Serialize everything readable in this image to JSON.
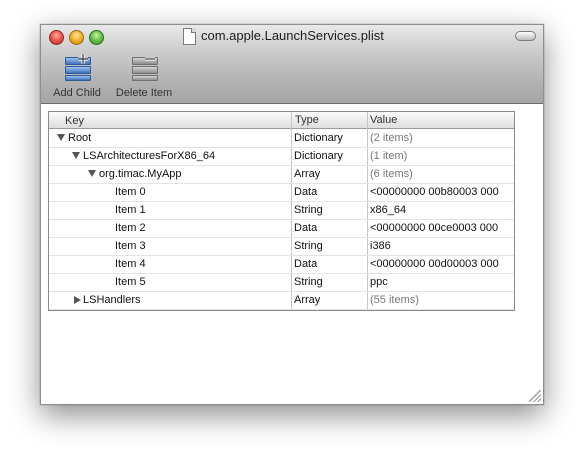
{
  "window": {
    "title": "com.apple.LaunchServices.plist"
  },
  "toolbar": {
    "add_child_label": "Add Child",
    "delete_item_label": "Delete Item"
  },
  "table": {
    "headers": {
      "key": "Key",
      "type": "Type",
      "value": "Value"
    },
    "rows": [
      {
        "key": "Root",
        "type": "Dictionary",
        "value": "(2 items)",
        "disclosure": "expanded"
      },
      {
        "key": "LSArchitecturesForX86_64",
        "type": "Dictionary",
        "value": "(1 item)",
        "disclosure": "expanded"
      },
      {
        "key": "org.timac.MyApp",
        "type": "Array",
        "value": "(6 items)",
        "disclosure": "expanded"
      },
      {
        "key": "Item 0",
        "type": "Data",
        "value": "<00000000 00b80003 000",
        "disclosure": "none"
      },
      {
        "key": "Item 1",
        "type": "String",
        "value": "x86_64",
        "disclosure": "none"
      },
      {
        "key": "Item 2",
        "type": "Data",
        "value": "<00000000 00ce0003 000",
        "disclosure": "none"
      },
      {
        "key": "Item 3",
        "type": "String",
        "value": "i386",
        "disclosure": "none"
      },
      {
        "key": "Item 4",
        "type": "Data",
        "value": "<00000000 00d00003 000",
        "disclosure": "none"
      },
      {
        "key": "Item 5",
        "type": "String",
        "value": "ppc",
        "disclosure": "none"
      },
      {
        "key": "LSHandlers",
        "type": "Array",
        "value": "(55 items)",
        "disclosure": "collapsed"
      }
    ]
  },
  "icons": {
    "close": "close-button-icon",
    "minimize": "minimize-button-icon",
    "zoom": "zoom-button-icon",
    "document": "plist-document-icon",
    "toolbar_toggle": "toolbar-toggle-icon",
    "add_child": "add-child-icon",
    "delete_item": "delete-item-icon",
    "disclosure_down": "disclosure-down-icon",
    "disclosure_right": "disclosure-right-icon",
    "resize": "resize-grip-icon"
  },
  "colors": {
    "close": "#f0574e",
    "minimize": "#f5b52d",
    "zoom": "#6fc34a",
    "add_accent": "#3f73bd"
  }
}
